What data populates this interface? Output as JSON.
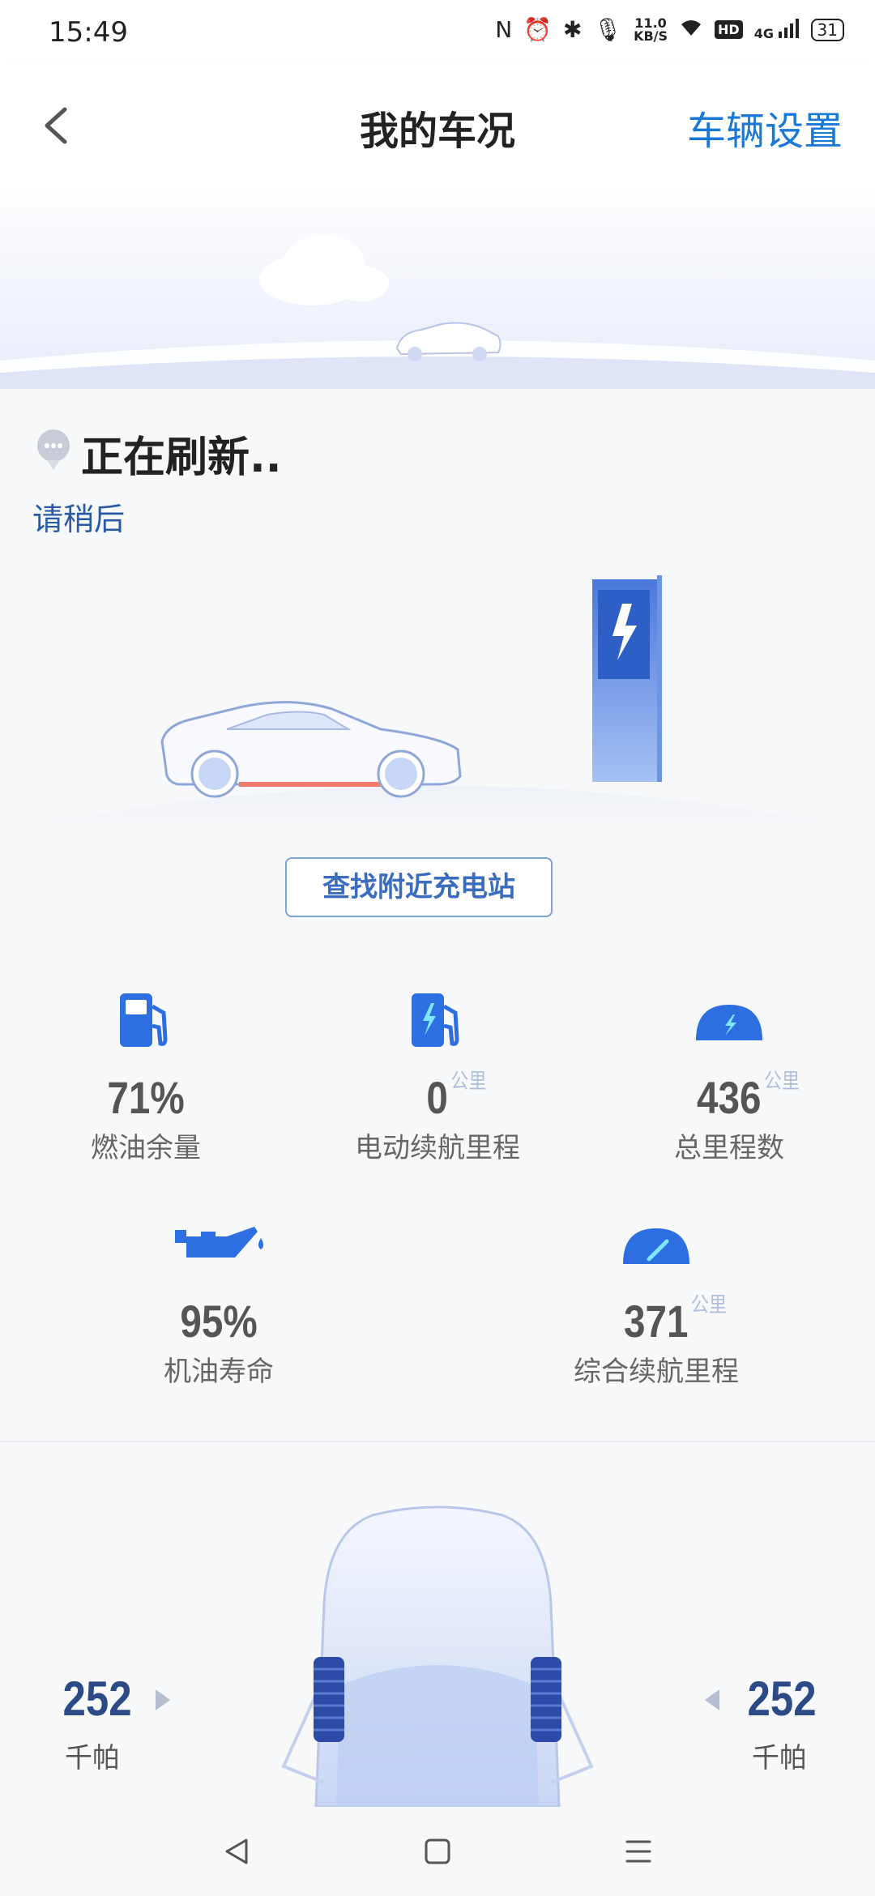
{
  "status_bar": {
    "time": "15:49",
    "net_speed_value": "11.0",
    "net_speed_unit": "KB/S",
    "network_type": "4G",
    "hd_label": "HD",
    "battery": "31"
  },
  "header": {
    "title": "我的车况",
    "settings_label": "车辆设置"
  },
  "refresh": {
    "title": "正在刷新..",
    "subtitle": "请稍后"
  },
  "find_station_label": "查找附近充电站",
  "stats": {
    "fuel": {
      "value": "71%",
      "label": "燃油余量"
    },
    "ev_range": {
      "value": "0",
      "unit": "公里",
      "label": "电动续航里程"
    },
    "odometer": {
      "value": "436",
      "unit": "公里",
      "label": "总里程数"
    },
    "oil_life": {
      "value": "95%",
      "label": "机油寿命"
    },
    "total_range": {
      "value": "371",
      "unit": "公里",
      "label": "综合续航里程"
    }
  },
  "tires": {
    "left": {
      "value": "252",
      "unit": "千帕"
    },
    "right": {
      "value": "252",
      "unit": "千帕"
    }
  },
  "colors": {
    "accent": "#1a78d6",
    "icon_blue": "#2d6fe0",
    "tire_value": "#2b4a86"
  }
}
